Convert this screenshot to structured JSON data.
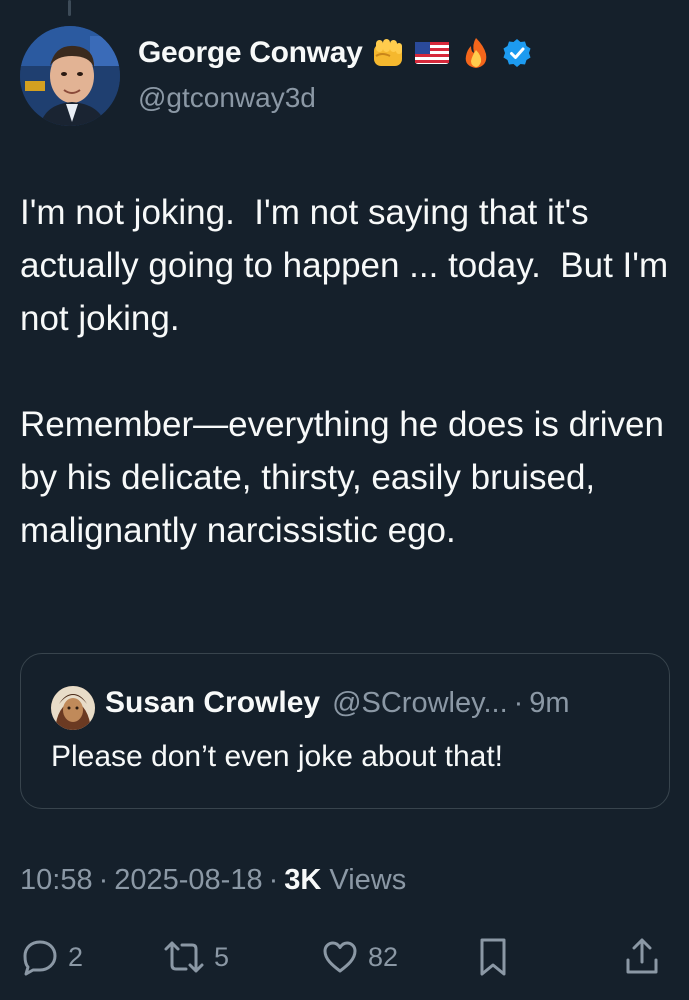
{
  "tweet": {
    "author": {
      "name": "George Conway",
      "handle": "@gtconway3d",
      "emojis": [
        "fist-icon",
        "us-flag-icon",
        "fire-icon"
      ],
      "verified": true,
      "verified_color": "#1d9bf0"
    },
    "text": "I'm not joking.  I'm not saying that it's actually going to happen ... today.  But I'm not joking.\n\nRemember—everything he does is driven by his delicate, thirsty, easily bruised, malignantly narcissistic ego.",
    "quoted": {
      "name": "Susan Crowley",
      "handle": "@SCrowley...",
      "time": "9m",
      "text": "Please don’t even joke about that!"
    },
    "time": "10:58",
    "date": "2025-08-18",
    "views_count": "3K",
    "views_label": "Views",
    "stats": {
      "replies": "2",
      "reposts": "5",
      "likes": "82"
    }
  },
  "theme": {
    "background": "#15202b",
    "text_primary": "#f7f9f9",
    "text_secondary": "#8b98a5",
    "border": "#38444d"
  }
}
